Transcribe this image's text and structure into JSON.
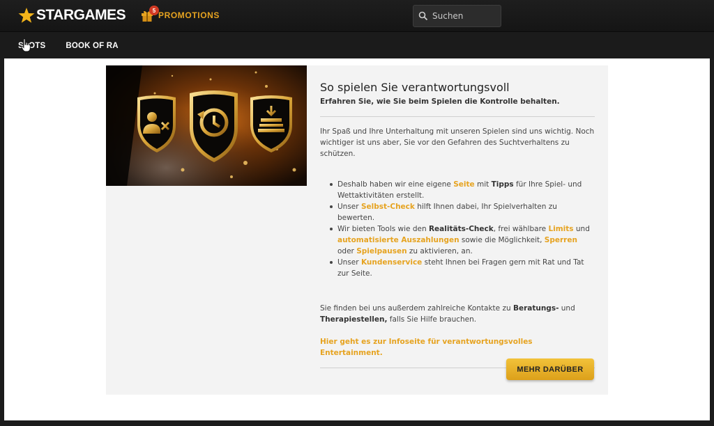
{
  "header": {
    "logo_text": "STARGAMES",
    "promotions_label": "PROMOTIONS",
    "promotions_count": "5",
    "search_placeholder": "Suchen"
  },
  "nav": {
    "items": [
      {
        "label": "SLOTS"
      },
      {
        "label": "BOOK OF RA"
      }
    ]
  },
  "content": {
    "title": "So spielen Sie verantwortungsvoll",
    "subtitle": "Erfahren Sie, wie Sie beim Spielen die Kontrolle behalten.",
    "intro": "Ihr Spaß und Ihre Unterhaltung mit unseren Spielen sind uns wichtig. Noch wichtiger ist uns aber, Sie vor den Gefahren des Suchtverhaltens zu schützen.",
    "bullet1": {
      "t1": "Deshalb haben wir eine eigene ",
      "link1": "Seite",
      "t2": " mit ",
      "bold1": "Tipps",
      "t3": " für Ihre Spiel- und Wettaktivitäten erstellt."
    },
    "bullet2": {
      "t1": "Unser ",
      "link1": "Selbst-Check",
      "t2": " hilft Ihnen dabei, Ihr Spielverhalten zu bewerten."
    },
    "bullet3": {
      "t1": "Wir bieten Tools wie den ",
      "bold1": "Realitäts-Check",
      "t2": ", frei wählbare ",
      "link1": "Limits",
      "t3": " und ",
      "link2": "automatisierte Auszahlungen",
      "t4": " sowie die Möglichkeit, ",
      "link3": "Sperren",
      "t5": " oder ",
      "link4": "Spielpausen",
      "t6": " zu aktivieren, an."
    },
    "bullet4": {
      "t1": "Unser ",
      "link1": "Kundenservice",
      "t2": " steht Ihnen bei Fragen gern mit Rat und Tat zur Seite."
    },
    "contacts": {
      "t1": "Sie finden bei uns außerdem zahlreiche Kontakte zu ",
      "bold1": "Beratungs-",
      "t2": " und ",
      "bold2": "Therapiestellen,",
      "t3": " falls Sie Hilfe brauchen."
    },
    "info_link": "Hier geht es zur Infoseite für verantwortungsvolles Entertainment.",
    "button_label": "MEHR DARÜBER"
  },
  "colors": {
    "accent": "#e6a320",
    "header_bg": "#1e1e1e",
    "card_bg": "#f3f3f3"
  },
  "icons": [
    "star-icon",
    "gift-icon",
    "search-icon",
    "user-block-shield-icon",
    "history-shield-icon",
    "deposit-shield-icon",
    "cursor-hand-icon"
  ]
}
